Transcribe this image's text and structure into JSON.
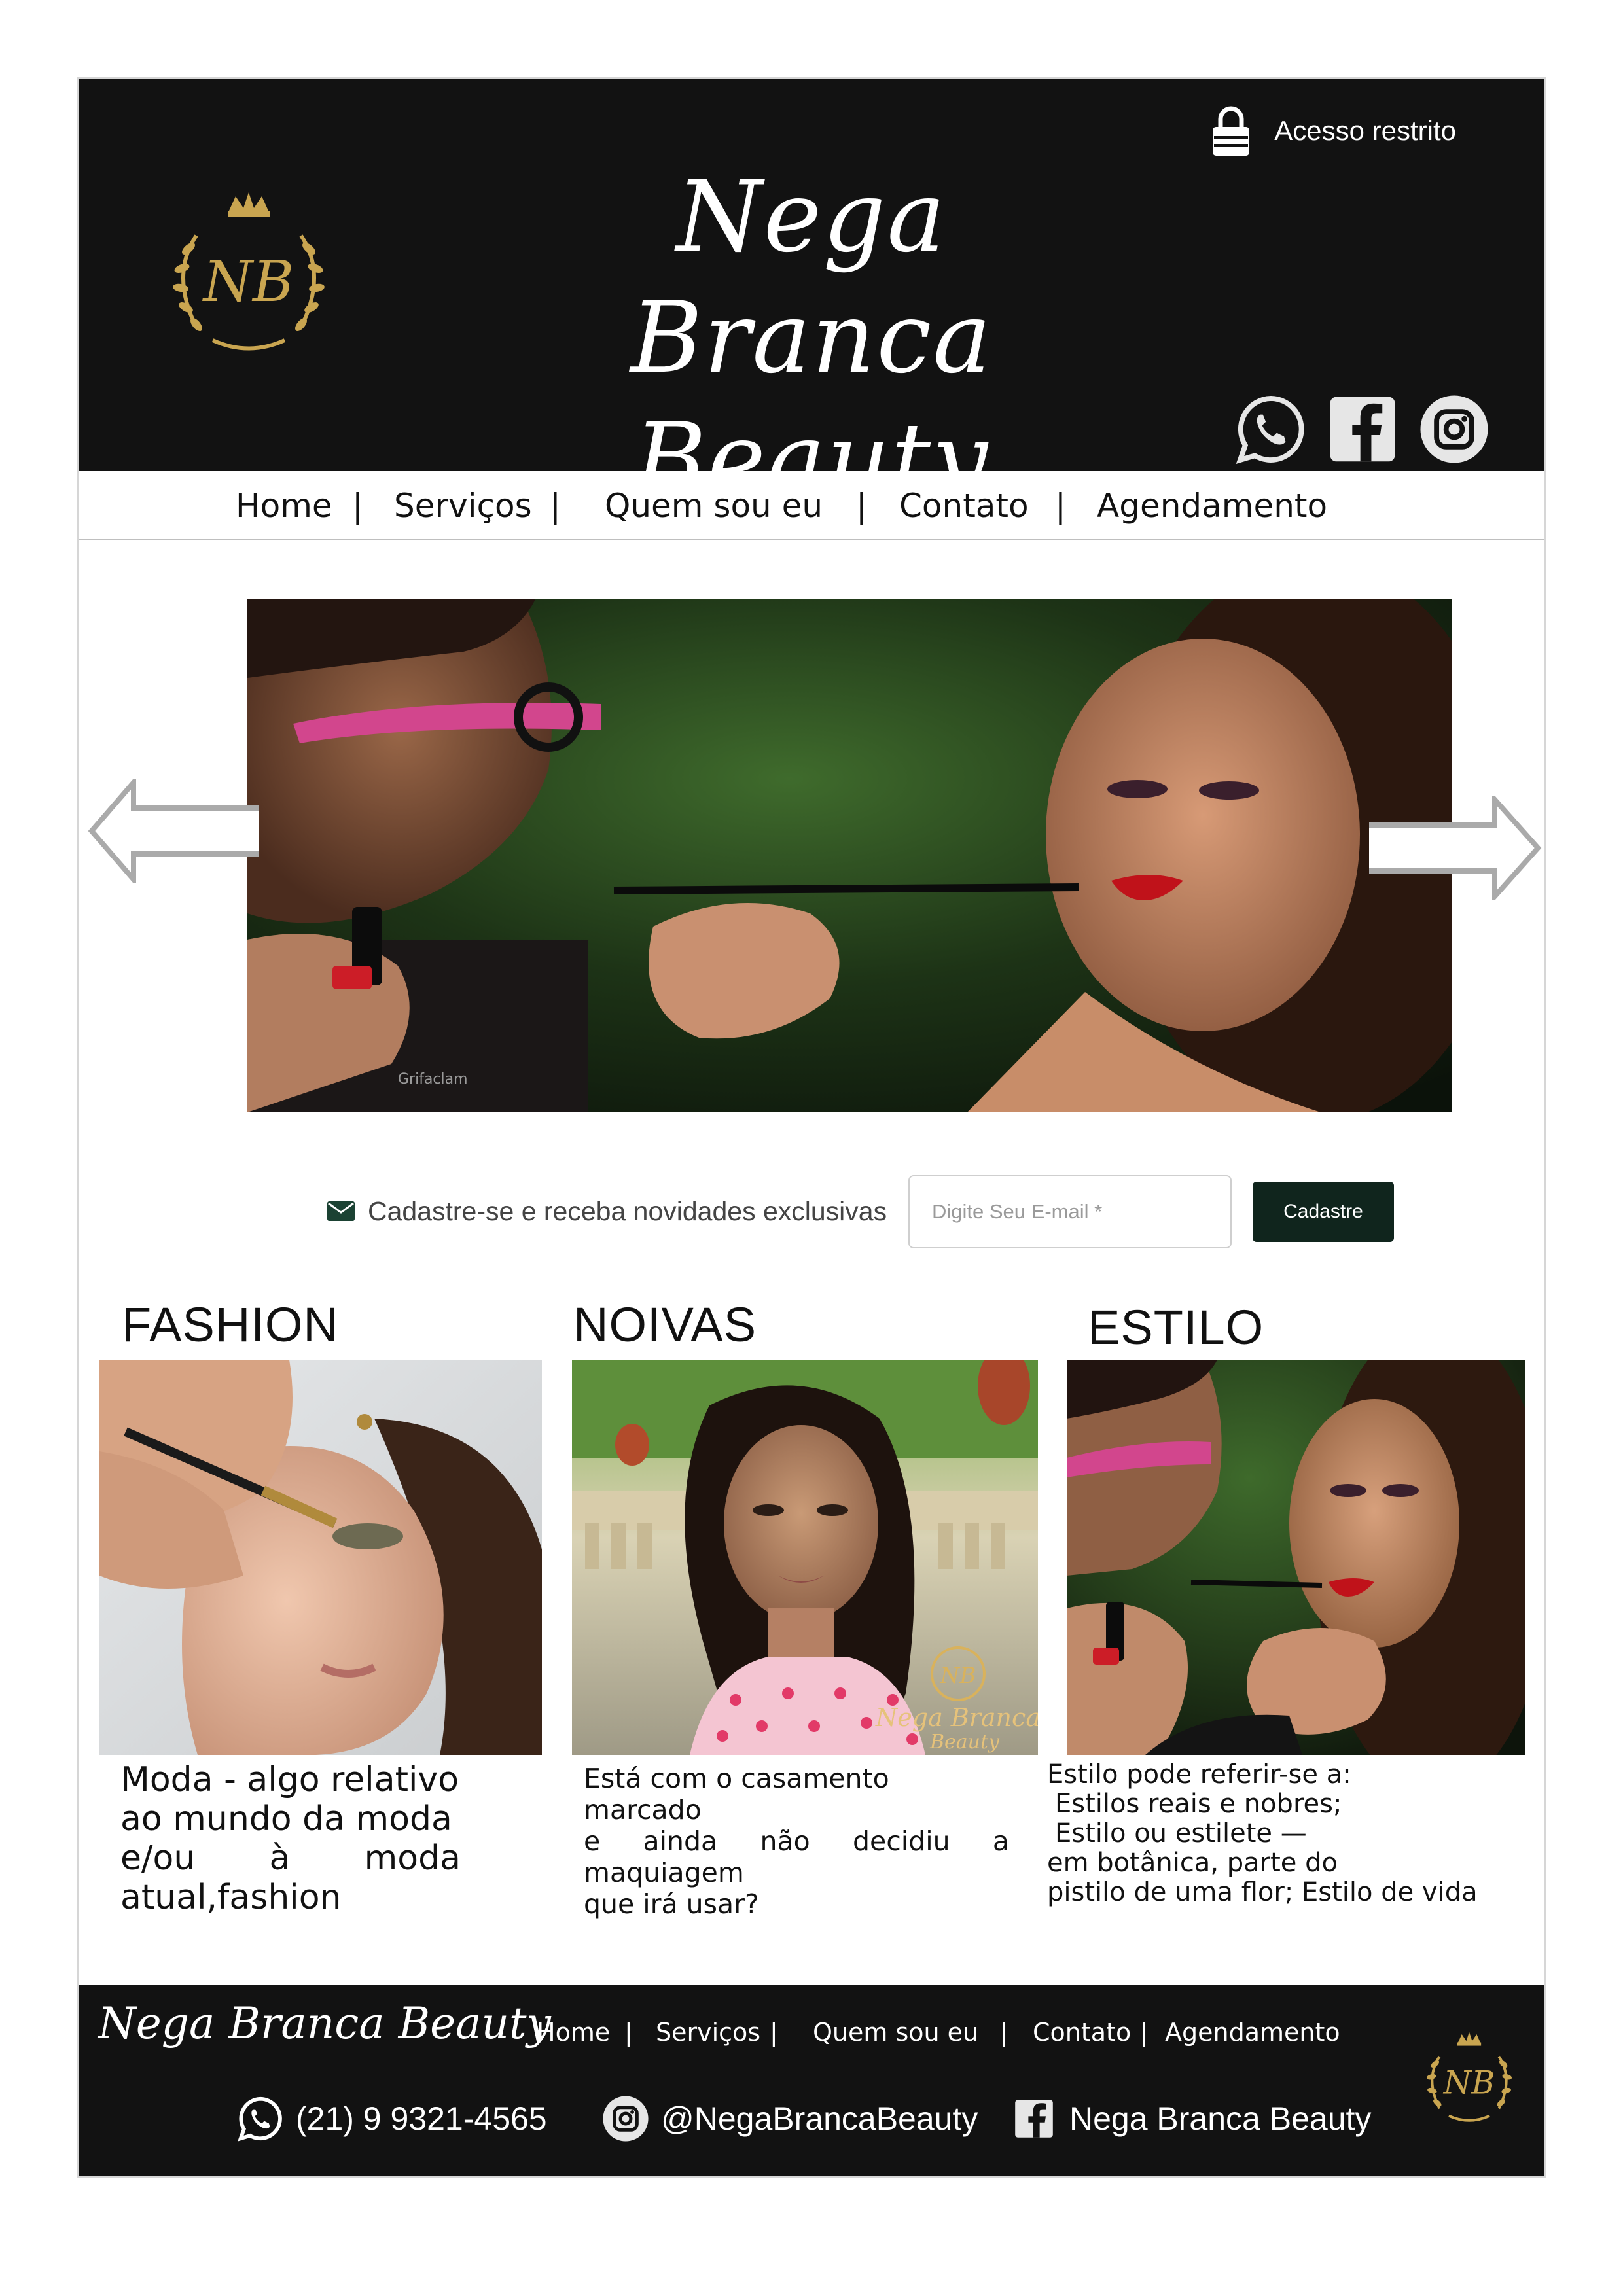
{
  "site": {
    "brand_line1": "Nega Branca",
    "brand_line2": "Beauty",
    "logo_monogram": "NB",
    "restricted_label": "Acesso restrito"
  },
  "nav": {
    "items": [
      "Home",
      "|",
      "Serviços",
      "|",
      "Quem sou eu",
      "|",
      "Contato",
      "|",
      "Agendamento"
    ]
  },
  "hero": {
    "prev_icon": "arrow-left-icon",
    "next_icon": "arrow-right-icon",
    "watermark": "Grifaclam"
  },
  "newsletter": {
    "icon": "envelope-icon",
    "text": "Cadastre-se e receba novidades exclusivas",
    "placeholder": "Digite Seu E-mail *",
    "button": "Cadastre"
  },
  "categories": [
    {
      "title": "FASHION",
      "lines": [
        "Moda - algo relativo",
        "ao mundo da moda",
        "e/ou",
        "à",
        "moda",
        "atual,fashion"
      ]
    },
    {
      "title": "NOIVAS",
      "lines": [
        "Está com o casamento marcado",
        "e",
        "ainda",
        "não",
        "decidiu",
        "a",
        "maquiagem",
        "que irá usar?"
      ],
      "watermark_line1": "Nega Branca",
      "watermark_line2": "Beauty"
    },
    {
      "title": "ESTILO",
      "lines": [
        "Estilo pode referir-se a:",
        "Estilos reais e nobres;",
        "Estilo ou estilete —",
        "em botânica, parte do",
        "pistilo de uma flor; Estilo de vida"
      ]
    }
  ],
  "footer": {
    "brand": "Nega Branca Beauty",
    "nav": [
      "Home",
      "|",
      "Serviços",
      "|",
      "Quem sou eu",
      "|",
      "Contato",
      "|",
      "Agendamento"
    ],
    "phone": "(21) 9 9321-4565",
    "instagram": "@NegaBrancaBeauty",
    "facebook": "Nega Branca Beauty"
  },
  "colors": {
    "header_bg": "#121212",
    "gold": "#c9a550",
    "button_bg": "#10251d",
    "text": "#111111"
  }
}
